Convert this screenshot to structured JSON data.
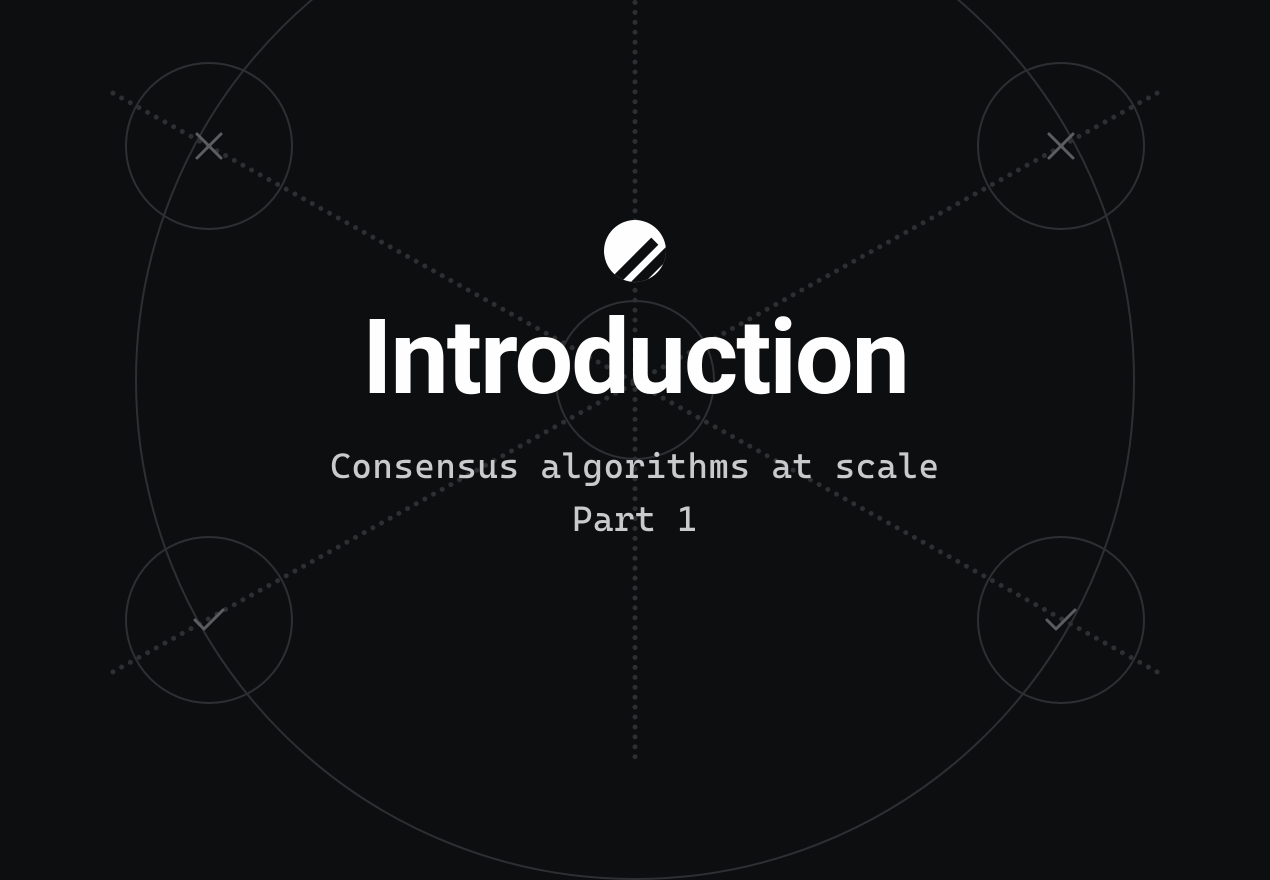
{
  "title": "Introduction",
  "subtitle_line1": "Consensus algorithms at scale",
  "subtitle_line2": "Part 1",
  "nodes": {
    "top_left": "x",
    "top_right": "x",
    "bottom_left": "check",
    "bottom_right": "check"
  }
}
